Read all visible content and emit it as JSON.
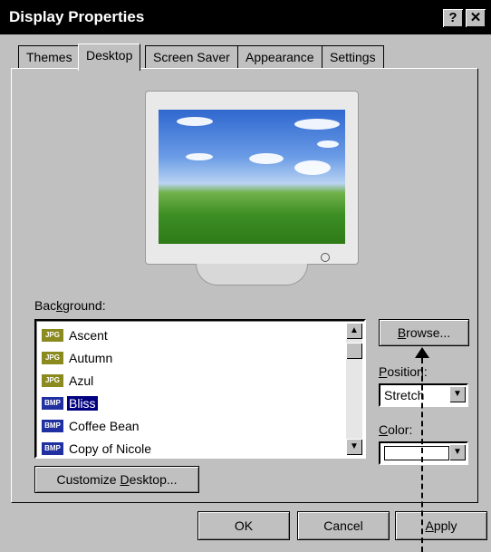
{
  "window": {
    "title": "Display Properties",
    "help_glyph": "?",
    "close_glyph": "✕"
  },
  "tabs": [
    {
      "label": "Themes"
    },
    {
      "label": "Desktop",
      "active": true
    },
    {
      "label": "Screen Saver"
    },
    {
      "label": "Appearance"
    },
    {
      "label": "Settings"
    }
  ],
  "desktop": {
    "background_label_pre": "Bac",
    "background_label_key": "k",
    "background_label_post": "ground:",
    "backgrounds": [
      {
        "icon": "jpg",
        "badge": "JPG",
        "name": "Ascent"
      },
      {
        "icon": "jpg",
        "badge": "JPG",
        "name": "Autumn"
      },
      {
        "icon": "jpg",
        "badge": "JPG",
        "name": "Azul"
      },
      {
        "icon": "bmp",
        "badge": "BMP",
        "name": "Bliss",
        "selected": true
      },
      {
        "icon": "bmp",
        "badge": "BMP",
        "name": "Coffee Bean"
      },
      {
        "icon": "bmp",
        "badge": "BMP",
        "name": "Copy of Nicole"
      }
    ],
    "browse_key": "B",
    "browse_rest": "rowse...",
    "position_key": "P",
    "position_rest": "osition:",
    "position_value": "Stretch",
    "color_key": "C",
    "color_rest": "olor:",
    "color_value": "#ffffff",
    "customize_pre": "Customize ",
    "customize_key": "D",
    "customize_post": "esktop..."
  },
  "buttons": {
    "ok": "OK",
    "cancel": "Cancel",
    "apply_key": "A",
    "apply_rest": "pply"
  }
}
